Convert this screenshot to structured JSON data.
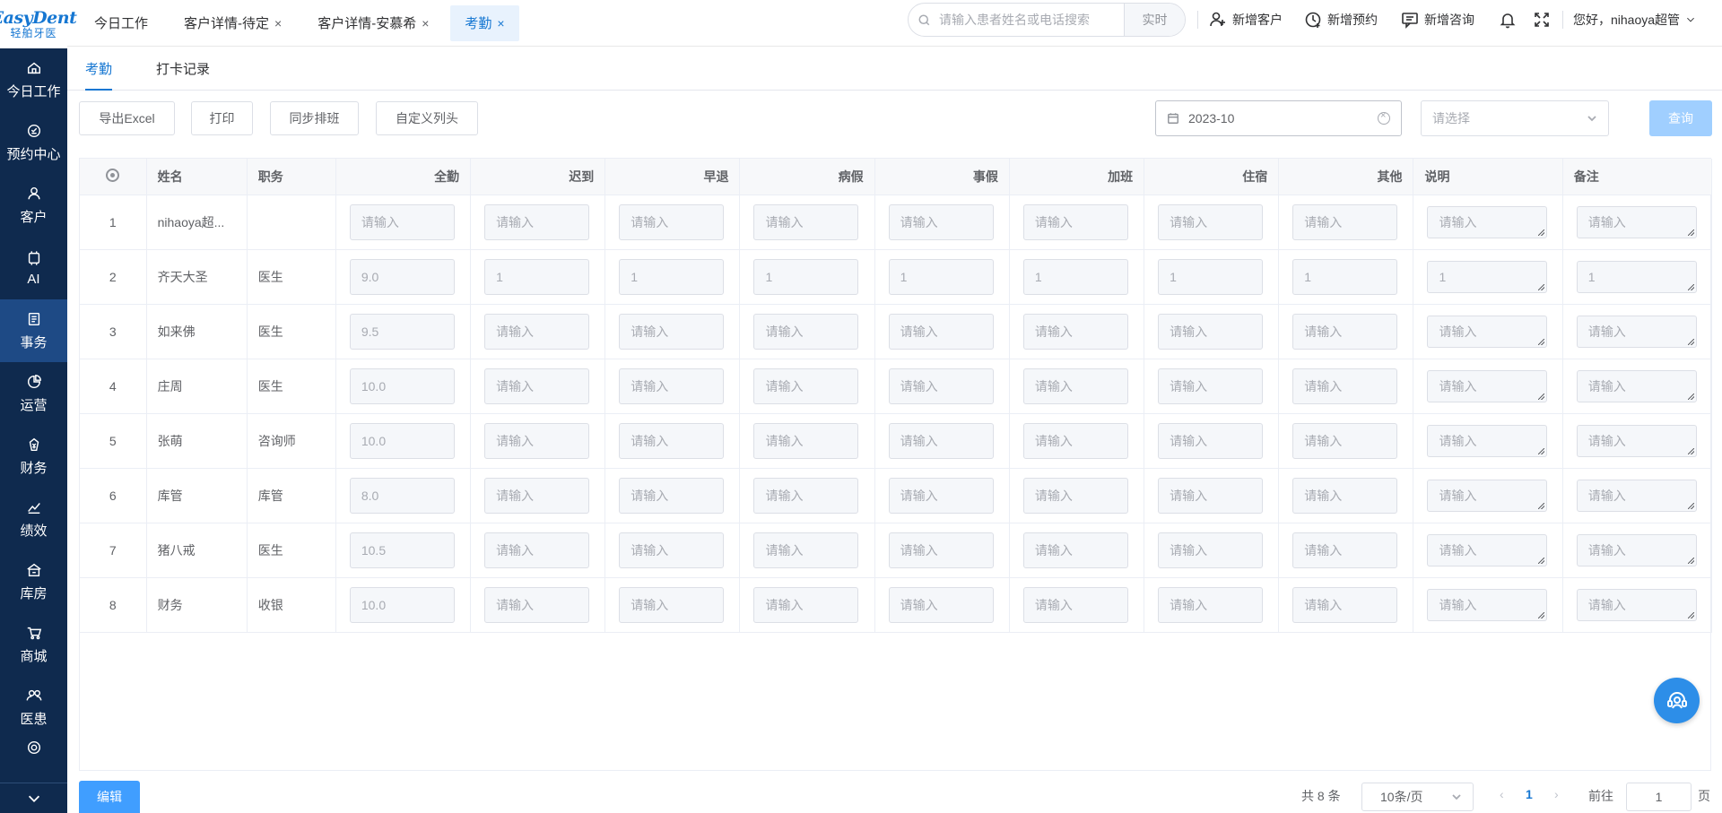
{
  "logo": {
    "brand": "EasyDent",
    "sub": "轻舶牙医"
  },
  "sidebar": {
    "items": [
      {
        "label": "今日工作",
        "icon": "home-icon"
      },
      {
        "label": "预约中心",
        "icon": "appointment-icon"
      },
      {
        "label": "客户",
        "icon": "user-icon"
      },
      {
        "label": "AI",
        "icon": "ai-chip-icon"
      },
      {
        "label": "事务",
        "icon": "document-icon",
        "active": true
      },
      {
        "label": "运营",
        "icon": "pie-chart-icon"
      },
      {
        "label": "财务",
        "icon": "finance-icon"
      },
      {
        "label": "绩效",
        "icon": "trend-icon"
      },
      {
        "label": "库房",
        "icon": "warehouse-icon"
      },
      {
        "label": "商城",
        "icon": "cart-icon"
      },
      {
        "label": "医患",
        "icon": "people-icon"
      }
    ]
  },
  "tabs": [
    {
      "label": "今日工作",
      "closable": false
    },
    {
      "label": "客户详情-待定",
      "closable": true
    },
    {
      "label": "客户详情-安慕希",
      "closable": true
    },
    {
      "label": "考勤",
      "closable": true,
      "active": true
    }
  ],
  "header": {
    "search_placeholder": "请输入患者姓名或电话搜索",
    "search_mode": "实时",
    "new_customer": "新增客户",
    "new_appointment": "新增预约",
    "new_consult": "新增咨询",
    "greeting": "您好，nihaoya超管"
  },
  "subtabs": [
    "考勤",
    "打卡记录"
  ],
  "toolbar": {
    "export": "导出Excel",
    "print": "打印",
    "sync": "同步排班",
    "custom_columns": "自定义列头",
    "month": "2023-10",
    "select_placeholder": "请选择",
    "query": "查询"
  },
  "table": {
    "columns": [
      "姓名",
      "职务",
      "全勤",
      "迟到",
      "早退",
      "病假",
      "事假",
      "加班",
      "住宿",
      "其他",
      "说明",
      "备注"
    ],
    "placeholder": "请输入",
    "rows": [
      {
        "no": "1",
        "name": "nihaoya超...",
        "role": "",
        "vals": [
          "",
          "",
          "",
          "",
          "",
          "",
          "",
          "",
          "",
          ""
        ]
      },
      {
        "no": "2",
        "name": "齐天大圣",
        "role": "医生",
        "vals": [
          "9.0",
          "1",
          "1",
          "1",
          "1",
          "1",
          "1",
          "1",
          "1",
          "1"
        ]
      },
      {
        "no": "3",
        "name": "如来佛",
        "role": "医生",
        "vals": [
          "9.5",
          "",
          "",
          "",
          "",
          "",
          "",
          "",
          "",
          ""
        ]
      },
      {
        "no": "4",
        "name": "庄周",
        "role": "医生",
        "vals": [
          "10.0",
          "",
          "",
          "",
          "",
          "",
          "",
          "",
          "",
          ""
        ]
      },
      {
        "no": "5",
        "name": "张萌",
        "role": "咨询师",
        "vals": [
          "10.0",
          "",
          "",
          "",
          "",
          "",
          "",
          "",
          "",
          ""
        ]
      },
      {
        "no": "6",
        "name": "库管",
        "role": "库管",
        "vals": [
          "8.0",
          "",
          "",
          "",
          "",
          "",
          "",
          "",
          "",
          ""
        ]
      },
      {
        "no": "7",
        "name": "猪八戒",
        "role": "医生",
        "vals": [
          "10.5",
          "",
          "",
          "",
          "",
          "",
          "",
          "",
          "",
          ""
        ]
      },
      {
        "no": "8",
        "name": "财务",
        "role": "收银",
        "vals": [
          "10.0",
          "",
          "",
          "",
          "",
          "",
          "",
          "",
          "",
          ""
        ]
      }
    ]
  },
  "footer": {
    "edit": "编辑",
    "total": "共 8 条",
    "page_size": "10条/页",
    "current_page": "1",
    "goto_label": "前往",
    "goto_value": "1",
    "page_unit": "页"
  }
}
